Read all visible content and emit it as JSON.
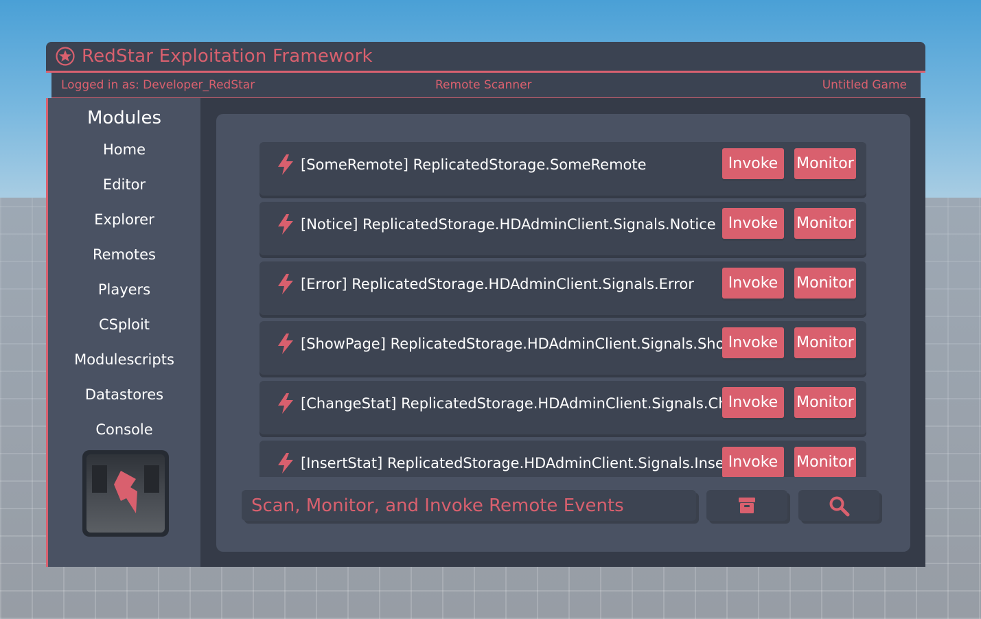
{
  "app": {
    "title": "RedStar Exploitation Framework"
  },
  "status": {
    "user": "Logged in as: Developer_RedStar",
    "current_module": "Remote Scanner",
    "game": "Untitled Game"
  },
  "sidebar": {
    "heading": "Modules",
    "items": [
      {
        "label": "Home"
      },
      {
        "label": "Editor"
      },
      {
        "label": "Explorer"
      },
      {
        "label": "Remotes"
      },
      {
        "label": "Players"
      },
      {
        "label": "CSploit"
      },
      {
        "label": "Modulescripts"
      },
      {
        "label": "Datastores"
      },
      {
        "label": "Console"
      }
    ]
  },
  "remotes": {
    "invoke_label": "Invoke",
    "monitor_label": "Monitor",
    "rows": [
      {
        "text": "[SomeRemote] ReplicatedStorage.SomeRemote"
      },
      {
        "text": "[Notice] ReplicatedStorage.HDAdminClient.Signals.Notice"
      },
      {
        "text": "[Error] ReplicatedStorage.HDAdminClient.Signals.Error"
      },
      {
        "text": "[ShowPage] ReplicatedStorage.HDAdminClient.Signals.ShowPage"
      },
      {
        "text": "[ChangeStat] ReplicatedStorage.HDAdminClient.Signals.ChangeStat"
      },
      {
        "text": "[InsertStat] ReplicatedStorage.HDAdminClient.Signals.InsertStat"
      }
    ]
  },
  "search": {
    "placeholder": "Scan, Monitor, and Invoke Remote Events"
  },
  "icons": {
    "logo": "star-circle-icon",
    "row": "lightning-bolt-icon",
    "archive": "archive-box-icon",
    "search": "magnifier-icon"
  },
  "colors": {
    "accent": "#d9606e",
    "panel": "#4a5263",
    "window": "#353b48",
    "row": "#3d4452"
  }
}
